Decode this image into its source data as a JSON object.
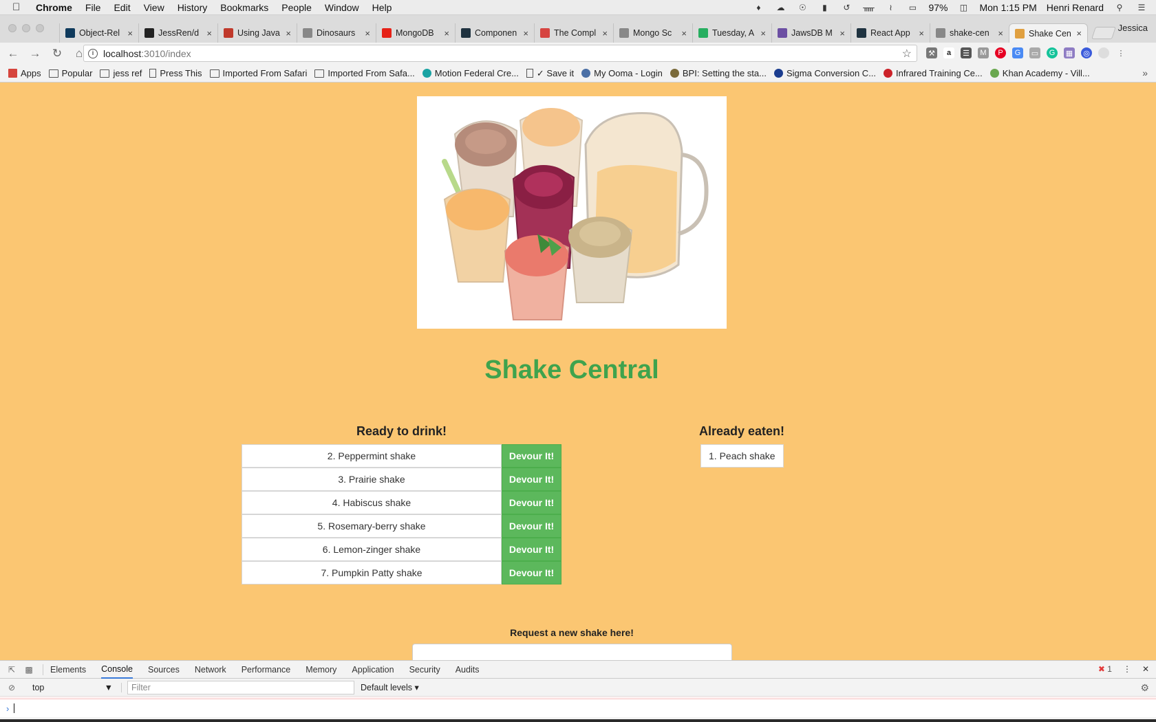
{
  "menubar": {
    "app_name": "Chrome",
    "items": [
      "File",
      "Edit",
      "View",
      "History",
      "Bookmarks",
      "People",
      "Window",
      "Help"
    ],
    "battery": "97%",
    "clock": "Mon 1:15 PM",
    "user": "Henri Renard"
  },
  "tabs": [
    {
      "title": "Object-Rel",
      "favicon_color": "#0f3a5c"
    },
    {
      "title": "JessRen/d",
      "favicon_color": "#222222"
    },
    {
      "title": "Using Java",
      "favicon_color": "#c0392b"
    },
    {
      "title": "Dinosaurs",
      "favicon_color": "#888888"
    },
    {
      "title": "MongoDB",
      "favicon_color": "#e62117"
    },
    {
      "title": "Componen",
      "favicon_color": "#1f3340"
    },
    {
      "title": "The Compl",
      "favicon_color": "#d64541"
    },
    {
      "title": "Mongo Sc",
      "favicon_color": "#888888"
    },
    {
      "title": "Tuesday, A",
      "favicon_color": "#27ae60"
    },
    {
      "title": "JawsDB M",
      "favicon_color": "#6c4fa3"
    },
    {
      "title": "React App",
      "favicon_color": "#1f3340"
    },
    {
      "title": "shake-cen",
      "favicon_color": "#888888"
    },
    {
      "title": "Shake Cen",
      "favicon_color": "#e0a040"
    }
  ],
  "profile_name": "Jessica",
  "address_bar": {
    "host": "localhost",
    "path": ":3010/index"
  },
  "bookmarks": [
    {
      "label": "Apps",
      "kind": "apps"
    },
    {
      "label": "Popular",
      "kind": "folder"
    },
    {
      "label": "jess ref",
      "kind": "folder"
    },
    {
      "label": "Press This",
      "kind": "page"
    },
    {
      "label": "Imported From Safari",
      "kind": "folder"
    },
    {
      "label": "Imported From Safa...",
      "kind": "folder"
    },
    {
      "label": "Motion Federal Cre...",
      "kind": "motion"
    },
    {
      "label": "✓ Save it",
      "kind": "page"
    },
    {
      "label": "My Ooma - Login",
      "kind": "gear"
    },
    {
      "label": "BPI: Setting the sta...",
      "kind": "bpi"
    },
    {
      "label": "Sigma Conversion C...",
      "kind": "sigma"
    },
    {
      "label": "Infrared Training Ce...",
      "kind": "itc"
    },
    {
      "label": "Khan Academy - Vill...",
      "kind": "leaf"
    }
  ],
  "page": {
    "title": "Shake Central",
    "ready_heading": "Ready to drink!",
    "eaten_heading": "Already eaten!",
    "devour_label": "Devour It!",
    "ready": [
      "2. Peppermint shake",
      "3. Prairie shake",
      "4. Habiscus shake",
      "5. Rosemary-berry shake",
      "6. Lemon-zinger shake",
      "7. Pumpkin Patty shake"
    ],
    "eaten": [
      "1. Peach shake"
    ],
    "request_label": "Request a new shake here!"
  },
  "devtools": {
    "tabs": [
      "Elements",
      "Console",
      "Sources",
      "Network",
      "Performance",
      "Memory",
      "Application",
      "Security",
      "Audits"
    ],
    "active_tab": "Console",
    "error_count": "1",
    "context": "top",
    "filter_placeholder": "Filter",
    "levels": "Default levels"
  }
}
